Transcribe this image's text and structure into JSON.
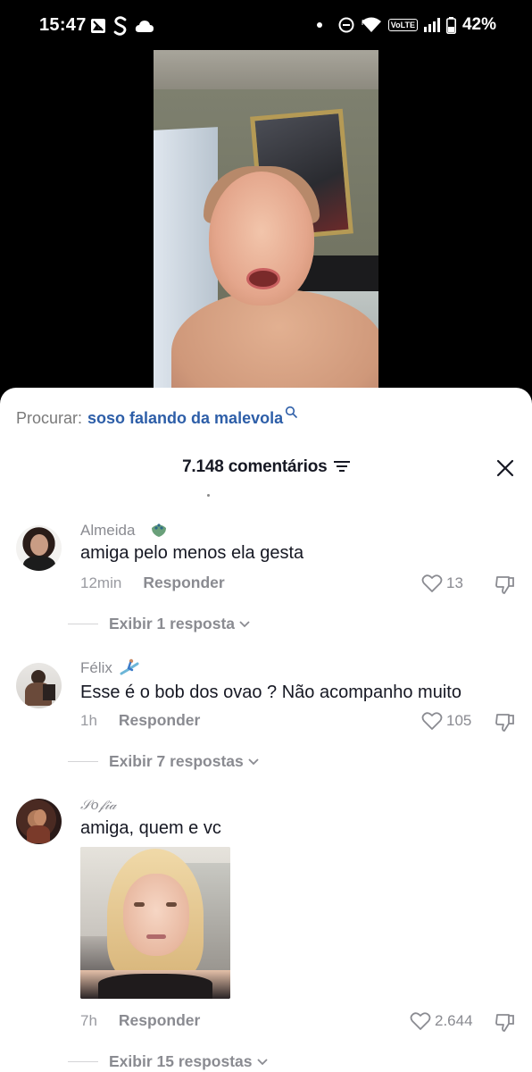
{
  "status_bar": {
    "time": "15:47",
    "battery": "42%",
    "network_badge": "VoLTE",
    "left_icons": [
      "photo-notification-icon",
      "s-app-icon",
      "cloud-icon"
    ],
    "right_icons": [
      "dot-icon",
      "do-not-disturb-icon",
      "wifi-icon",
      "volte-icon",
      "signal-icon",
      "battery-icon"
    ]
  },
  "video": {
    "description_icon": "video-frame"
  },
  "search": {
    "label": "Procurar:",
    "term": "soso falando da malevola"
  },
  "header": {
    "comments_count": "7.148 comentários"
  },
  "comments": [
    {
      "username": "Almeida",
      "badge": "peacock-emoji",
      "text": "amiga pelo menos ela gesta",
      "time": "12min",
      "reply_label": "Responder",
      "likes": "13",
      "view_replies": "Exibir 1 resposta"
    },
    {
      "username": "Félix",
      "badge": "surfer-emoji",
      "text": "Esse é o bob dos ovao ? Não acompanho muito",
      "time": "1h",
      "reply_label": "Responder",
      "likes": "105",
      "view_replies": "Exibir 7 respostas"
    },
    {
      "username": "𝒮𝑜𝒻𝒾𝒶",
      "text": "amiga, quem e vc",
      "has_gif": true,
      "time": "7h",
      "reply_label": "Responder",
      "likes": "2.644",
      "view_replies": "Exibir 15 respostas"
    }
  ]
}
